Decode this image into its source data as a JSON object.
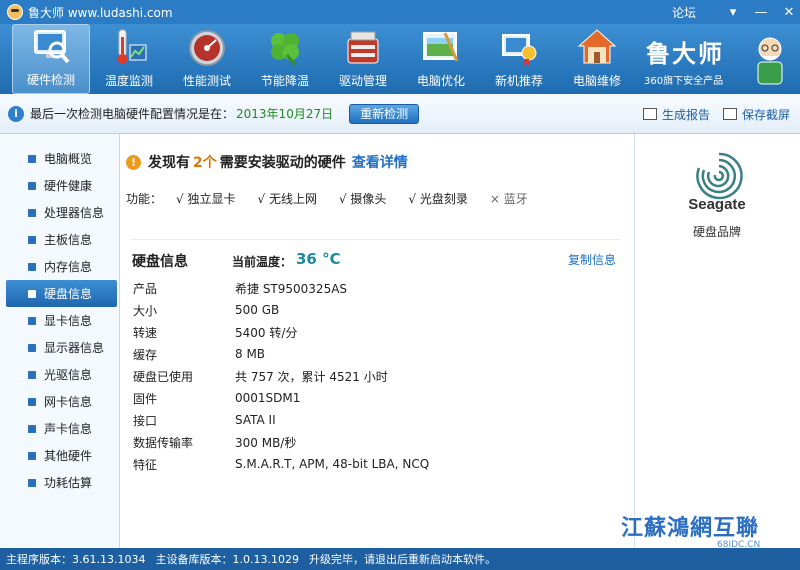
{
  "window": {
    "title": "鲁大师 www.ludashi.com",
    "forum": "论坛"
  },
  "toolbar": {
    "items": [
      {
        "label": "硬件检测",
        "icon": "monitor-magnifier-icon"
      },
      {
        "label": "温度监测",
        "icon": "thermometer-icon"
      },
      {
        "label": "性能测试",
        "icon": "speedometer-icon"
      },
      {
        "label": "节能降温",
        "icon": "clover-icon"
      },
      {
        "label": "驱动管理",
        "icon": "toolbox-icon"
      },
      {
        "label": "电脑优化",
        "icon": "window-brush-icon"
      },
      {
        "label": "新机推荐",
        "icon": "award-medal-icon"
      },
      {
        "label": "电脑维修",
        "icon": "house-icon"
      }
    ],
    "active_index": 0
  },
  "brand": {
    "logo": "鲁大师",
    "subtitle": "360旗下安全产品"
  },
  "infobar": {
    "message": "最后一次检测电脑硬件配置情况是在：",
    "date": "2013年10月27日",
    "recheck_label": "重新检测",
    "report_label": "生成报告",
    "screenshot_label": "保存截屏"
  },
  "sidebar": {
    "items": [
      {
        "label": "电脑概览"
      },
      {
        "label": "硬件健康"
      },
      {
        "label": "处理器信息"
      },
      {
        "label": "主板信息"
      },
      {
        "label": "内存信息"
      },
      {
        "label": "硬盘信息"
      },
      {
        "label": "显卡信息"
      },
      {
        "label": "显示器信息"
      },
      {
        "label": "光驱信息"
      },
      {
        "label": "网卡信息"
      },
      {
        "label": "声卡信息"
      },
      {
        "label": "其他硬件"
      },
      {
        "label": "功耗估算"
      }
    ],
    "active_index": 5
  },
  "alert": {
    "prefix": "发现有",
    "count": "2个",
    "suffix": "需要安装驱动的硬件",
    "link": "查看详情"
  },
  "features": {
    "label": "功能：",
    "items": [
      {
        "text": "√ 独立显卡",
        "enabled": true
      },
      {
        "text": "√ 无线上网",
        "enabled": true
      },
      {
        "text": "√ 摄像头",
        "enabled": true
      },
      {
        "text": "√ 光盘刻录",
        "enabled": true
      },
      {
        "text": "× 蓝牙",
        "enabled": false
      }
    ]
  },
  "disk": {
    "title": "硬盘信息",
    "temp_label": "当前温度：",
    "temp_value": "36 °C",
    "copy_label": "复制信息",
    "rows": [
      {
        "k": "产品",
        "v": "希捷 ST9500325AS"
      },
      {
        "k": "大小",
        "v": "500 GB"
      },
      {
        "k": "转速",
        "v": "5400 转/分"
      },
      {
        "k": "缓存",
        "v": "8 MB"
      },
      {
        "k": "硬盘已使用",
        "v": "共 757 次，累计 4521 小时"
      },
      {
        "k": "固件",
        "v": "0001SDM1"
      },
      {
        "k": "接口",
        "v": "SATA II"
      },
      {
        "k": "数据传输率",
        "v": "300 MB/秒"
      },
      {
        "k": "特征",
        "v": "S.M.A.R.T,  APM,  48-bit LBA,  NCQ"
      }
    ]
  },
  "right_panel": {
    "brand_name": "Seagate",
    "caption": "硬盘品牌",
    "watermark": "江蘇鴻網互聯",
    "watermark_url": "68IDC.CN"
  },
  "footer": {
    "main_version": "主程序版本：3.61.13.1034",
    "db_version": "主设备库版本：1.0.13.1029",
    "status": "升级完毕，请退出后重新启动本软件。"
  },
  "colors": {
    "accent": "#1f6bb0",
    "date": "#1f8a1f",
    "temperature": "#1a8a9c",
    "warning": "#e07400",
    "link": "#1f6fc7"
  }
}
